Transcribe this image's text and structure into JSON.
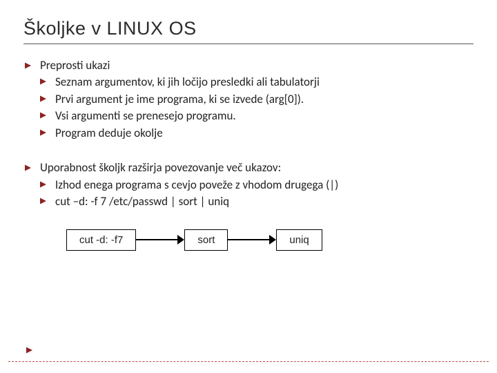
{
  "title": "Školjke v LINUX OS",
  "bullets": [
    {
      "text": "Preprosti ukazi",
      "sub": [
        "Seznam argumentov, ki jih ločijo presledki ali tabulatorji",
        "Prvi argument je ime programa, ki se izvede (arg[0]).",
        "Vsi argumenti se prenesejo programu.",
        "Program deduje okolje"
      ]
    },
    {
      "text": "Uporabnost školjk razširja povezovanje več ukazov:",
      "sub": [
        "Izhod enega programa s cevjo poveže z vhodom drugega (|)",
        "cut –d: -f 7 /etc/passwd | sort | uniq"
      ]
    }
  ],
  "diagram": {
    "boxes": [
      "cut -d: -f7",
      "sort",
      "uniq"
    ]
  },
  "marker_color": "#8e2323"
}
